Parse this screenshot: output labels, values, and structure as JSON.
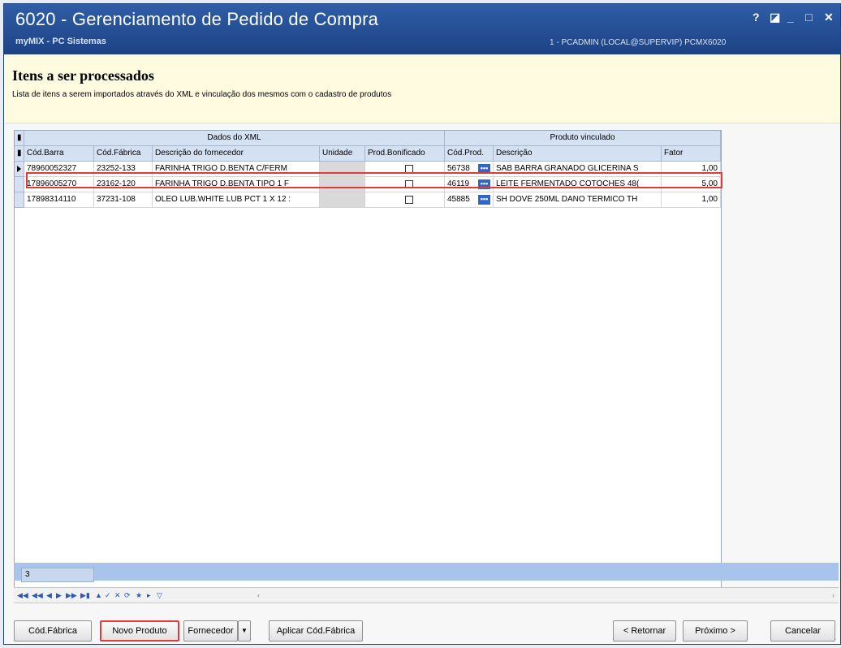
{
  "window": {
    "title": "6020 - Gerenciamento de Pedido de Compra",
    "subtitle": "myMIX - PC Sistemas",
    "user_info": "1 - PCADMIN (LOCAL@SUPERVIP)   PCMX6020",
    "help": "?",
    "restore": "◪",
    "minimize": "_",
    "maximize": "□",
    "close": "✕"
  },
  "header": {
    "title": "Itens a ser processados",
    "description": "Lista de itens a serem importados através do XML e vinculação dos mesmos com o cadastro de produtos"
  },
  "grid": {
    "band_left": "Dados do XML",
    "band_right": "Produto vinculado",
    "columns": {
      "cod_barra": "Cód.Barra",
      "cod_fabrica": "Cód.Fábrica",
      "descricao_fornecedor": "Descrição do fornecedor",
      "unidade": "Unidade",
      "prod_bonificado": "Prod.Bonificado",
      "cod_prod": "Cód.Prod.",
      "descricao": "Descrição",
      "fator": "Fator"
    },
    "rows": [
      {
        "cod_barra": "78960052327",
        "cod_fabrica": "23252-133",
        "descricao_fornecedor": "FARINHA TRIGO D.BENTA C/FERM",
        "unidade": "",
        "prod_bonificado": false,
        "cod_prod": "56738",
        "descricao": "SAB BARRA GRANADO GLICERINA S",
        "fator": "1,00"
      },
      {
        "cod_barra": "17896005270",
        "cod_fabrica": "23162-120",
        "descricao_fornecedor": "FARINHA TRIGO D.BENTA TIPO 1 F",
        "unidade": "",
        "prod_bonificado": false,
        "cod_prod": "46119",
        "descricao": "LEITE FERMENTADO COTOCHES 48(",
        "fator": "5,00"
      },
      {
        "cod_barra": "17898314110",
        "cod_fabrica": "37231-108",
        "descricao_fornecedor": "OLEO LUB.WHITE LUB PCT 1 X 12 :",
        "unidade": "",
        "prod_bonificado": false,
        "cod_prod": "45885",
        "descricao": "SH DOVE 250ML DANO TERMICO TH",
        "fator": "1,00"
      }
    ],
    "record_count": "3"
  },
  "buttons": {
    "cod_fabrica": "Cód.Fábrica",
    "novo_produto": "Novo Produto",
    "fornecedor": "Fornecedor",
    "aplicar": "Aplicar Cód.Fábrica",
    "retornar": "< Retornar",
    "proximo": "Próximo >",
    "cancelar": "Cancelar"
  },
  "colors": {
    "title_bar": "#1d4185",
    "header_bg": "#fffbe0",
    "highlight": "#e03b3b",
    "grid_header": "#d4e1f2"
  }
}
